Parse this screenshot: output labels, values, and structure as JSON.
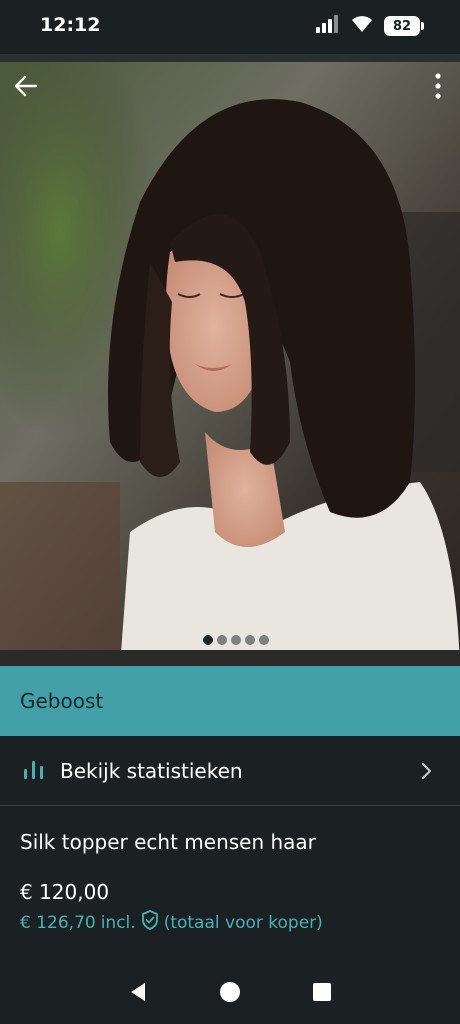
{
  "status_bar": {
    "time": "12:12",
    "battery": "82",
    "icons": [
      "signal-icon",
      "wifi-icon",
      "battery-icon"
    ]
  },
  "photo": {
    "page_count": 5,
    "active_page": 1,
    "icons": [
      "back-arrow-icon",
      "more-vertical-icon"
    ]
  },
  "boost": {
    "label": "Geboost",
    "color": "#44a0a8"
  },
  "stats": {
    "label": "Bekijk statistieken",
    "icon": "bar-chart-icon",
    "chevron": "chevron-right-icon"
  },
  "listing": {
    "title": "Silk topper echt mensen haar",
    "price": "€ 120,00",
    "price_incl": "€ 126,70",
    "incl_label": "incl.",
    "incl_note": "(totaal voor koper)",
    "shield_icon": "shield-check-icon"
  },
  "colors": {
    "background": "#1b2122",
    "accent": "#44a0a8",
    "accent_text": "#4ab0b6"
  },
  "nav": {
    "icons": [
      "back-triangle-icon",
      "home-circle-icon",
      "recents-square-icon"
    ]
  }
}
